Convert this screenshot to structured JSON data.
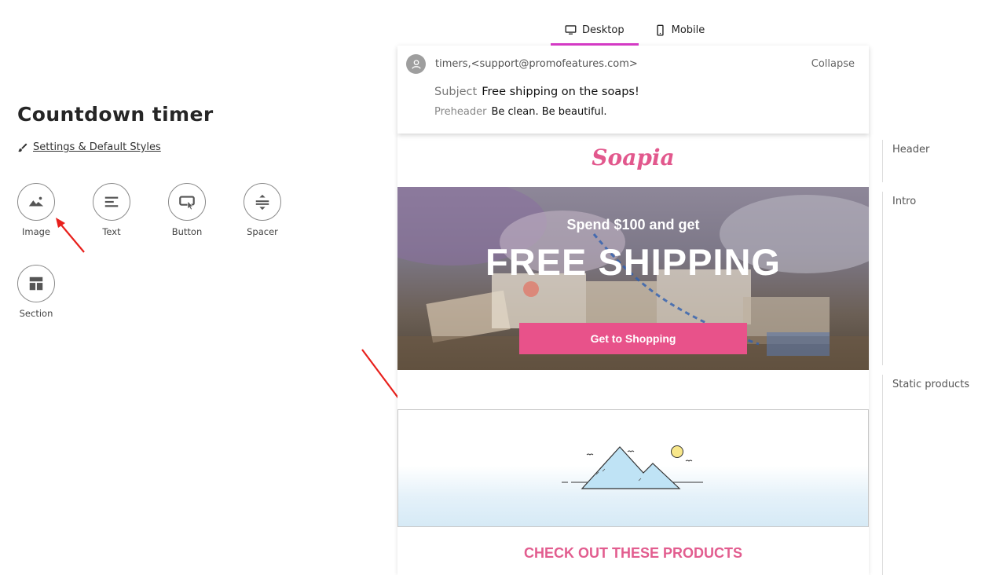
{
  "panel": {
    "title": "Countdown timer",
    "settings_link": "Settings & Default Styles",
    "tools": [
      {
        "label": "Image",
        "icon": "image-icon"
      },
      {
        "label": "Text",
        "icon": "text-icon"
      },
      {
        "label": "Button",
        "icon": "button-icon"
      },
      {
        "label": "Spacer",
        "icon": "spacer-icon"
      },
      {
        "label": "Section",
        "icon": "section-icon"
      }
    ]
  },
  "tabs": {
    "desktop": "Desktop",
    "mobile": "Mobile",
    "active": "Desktop",
    "accent_color": "#d93cc9"
  },
  "email": {
    "from": "timers,<support@promofeatures.com>",
    "collapse": "Collapse",
    "subject_label": "Subject",
    "subject": "Free shipping on the soaps!",
    "preheader_label": "Preheader",
    "preheader": "Be clean. Be beautiful.",
    "logo": "Soapia",
    "hero": {
      "line1": "Spend $100 and get",
      "line2": "FREE SHIPPING",
      "cta": "Get to Shopping"
    },
    "products_title": "CHECK OUT THESE PRODUCTS",
    "brand_color": "#e8528a"
  },
  "rail": {
    "sections": [
      "Header",
      "Intro",
      "Static products"
    ]
  }
}
